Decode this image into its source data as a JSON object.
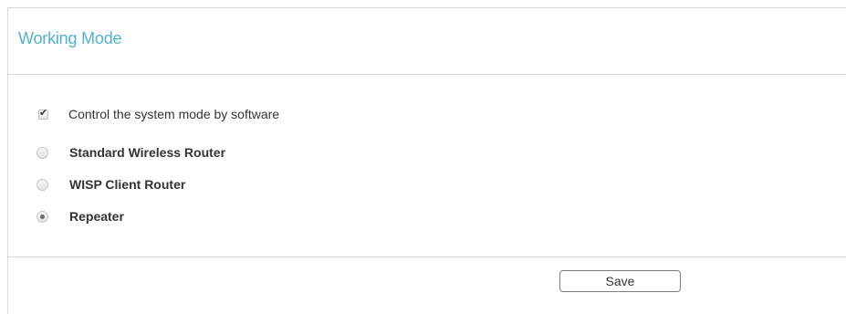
{
  "panel": {
    "title": "Working Mode"
  },
  "software_control": {
    "label": "Control the system mode by software",
    "checked": true
  },
  "modes": [
    {
      "label": "Standard Wireless Router",
      "selected": false
    },
    {
      "label": "WISP Client Router",
      "selected": false
    },
    {
      "label": "Repeater",
      "selected": true
    }
  ],
  "actions": {
    "save_label": "Save"
  },
  "colors": {
    "title": "#4fb3cf",
    "text": "#333333",
    "divider": "#d6d6d6"
  }
}
